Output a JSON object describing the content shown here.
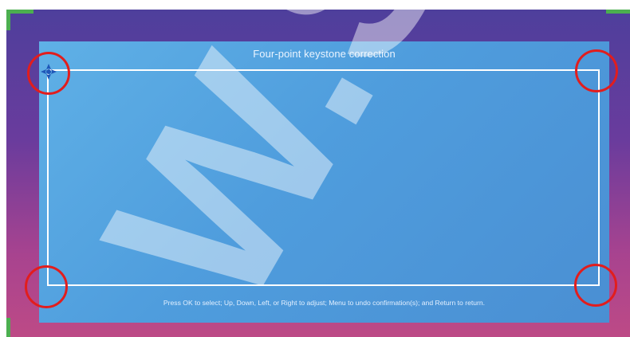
{
  "dialog": {
    "title": "Four-point keystone correction",
    "hint": "Press OK to select; Up, Down, Left, or Right to adjust; Menu to undo confirmation(s); and Return to return."
  },
  "watermark": "W.S",
  "colors": {
    "background_top": "#4e3f9c",
    "background_bottom": "#bd4a86",
    "panel": "#4f9ddd",
    "frame": "#ffffff",
    "handle_highlight": "#e21d1d",
    "corner_marker": "#4caf50",
    "selected_cursor": "#1f57b8"
  },
  "corner_handles": [
    "top-left",
    "top-right",
    "bottom-left",
    "bottom-right"
  ],
  "selected_corner": "top-left",
  "icons": {
    "selected_corner_cursor": "crosshair-arrows-icon"
  }
}
